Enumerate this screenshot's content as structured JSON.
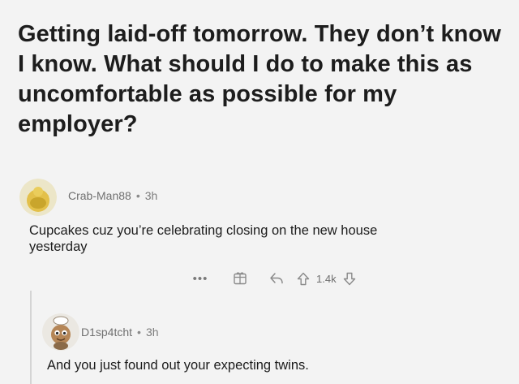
{
  "post": {
    "title": "Getting laid-off tomorrow. They don’t know I know. What should I do to make this as uncomfortable as possible for my employer?"
  },
  "comments": [
    {
      "author": "Crab-Man88",
      "separator": "•",
      "age": "3h",
      "avatar": "snoo-avatar-yellow-icon",
      "body": "Cupcakes cuz you’re celebrating closing on the new house yesterday",
      "actions": {
        "more_label": "•••",
        "award_icon": "award-icon",
        "reply_icon": "reply-icon",
        "upvote_icon": "upvote-icon",
        "vote_count": "1.4k",
        "downvote_icon": "downvote-icon"
      }
    },
    {
      "author": "D1sp4tcht",
      "separator": "•",
      "age": "3h",
      "avatar": "snoo-avatar-cartoon-icon",
      "body": "And you just found out your expecting twins."
    }
  ],
  "colors": {
    "background": "#f3f3f3",
    "text": "#1c1c1c",
    "meta": "#7c7c7c",
    "avatar_yellow": "#e8c64a"
  }
}
